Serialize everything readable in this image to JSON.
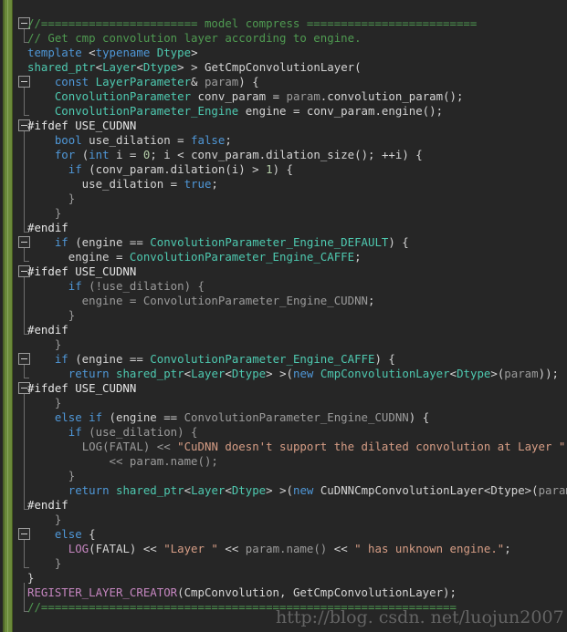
{
  "editor": {
    "background_color": "#262626",
    "change_bar_color": "#6b8a3a",
    "font_size_px": 12.4,
    "line_height_px": 16,
    "language": "C++",
    "colors": {
      "plain": "#d4d4d4",
      "comment": "#4f9a51",
      "keyword": "#4f97d7",
      "type": "#4ec9b0",
      "preprocessor": "#e6e6e6",
      "string": "#d69d85",
      "macro": "#c586c0",
      "variable": "#9b9b9b",
      "number": "#b5cea8"
    }
  },
  "watermark": {
    "text": "http://blog. csdn. net/luojun2007"
  },
  "fold_markers": [
    {
      "name": "fold-marker-model-compress-comment",
      "line": 1,
      "state": "expanded"
    },
    {
      "name": "fold-marker-function-body",
      "line": 5,
      "state": "expanded"
    },
    {
      "name": "fold-marker-ifdef-use-cudnn-1",
      "line": 8,
      "state": "expanded"
    },
    {
      "name": "fold-marker-if-engine-default",
      "line": 16,
      "state": "expanded"
    },
    {
      "name": "fold-marker-ifdef-use-cudnn-2",
      "line": 18,
      "state": "expanded"
    },
    {
      "name": "fold-marker-if-engine-caffe",
      "line": 24,
      "state": "expanded"
    },
    {
      "name": "fold-marker-ifdef-use-cudnn-3",
      "line": 26,
      "state": "expanded"
    },
    {
      "name": "fold-marker-else-block",
      "line": 36,
      "state": "expanded"
    }
  ],
  "code_lines": [
    {
      "n": 1,
      "text": "//======================= model compress ========================="
    },
    {
      "n": 2,
      "text": "// Get cmp convolution layer according to engine."
    },
    {
      "n": 3,
      "text": "template <typename Dtype>"
    },
    {
      "n": 4,
      "text": "shared_ptr<Layer<Dtype> > GetCmpConvolutionLayer("
    },
    {
      "n": 5,
      "text": "    const LayerParameter& param) {"
    },
    {
      "n": 6,
      "text": "    ConvolutionParameter conv_param = param.convolution_param();"
    },
    {
      "n": 7,
      "text": "    ConvolutionParameter_Engine engine = conv_param.engine();"
    },
    {
      "n": 8,
      "text": "#ifdef USE_CUDNN"
    },
    {
      "n": 9,
      "text": "    bool use_dilation = false;"
    },
    {
      "n": 10,
      "text": "    for (int i = 0; i < conv_param.dilation_size(); ++i) {"
    },
    {
      "n": 11,
      "text": "      if (conv_param.dilation(i) > 1) {"
    },
    {
      "n": 12,
      "text": "        use_dilation = true;"
    },
    {
      "n": 13,
      "text": "      }"
    },
    {
      "n": 14,
      "text": "    }"
    },
    {
      "n": 15,
      "text": "#endif"
    },
    {
      "n": 16,
      "text": "    if (engine == ConvolutionParameter_Engine_DEFAULT) {"
    },
    {
      "n": 17,
      "text": "      engine = ConvolutionParameter_Engine_CAFFE;"
    },
    {
      "n": 18,
      "text": "#ifdef USE_CUDNN"
    },
    {
      "n": 19,
      "text": "      if (!use_dilation) {"
    },
    {
      "n": 20,
      "text": "        engine = ConvolutionParameter_Engine_CUDNN;"
    },
    {
      "n": 21,
      "text": "      }"
    },
    {
      "n": 22,
      "text": "#endif"
    },
    {
      "n": 23,
      "text": "    }"
    },
    {
      "n": 24,
      "text": "    if (engine == ConvolutionParameter_Engine_CAFFE) {"
    },
    {
      "n": 25,
      "text": "      return shared_ptr<Layer<Dtype> >(new CmpConvolutionLayer<Dtype>(param));"
    },
    {
      "n": 26,
      "text": "#ifdef USE_CUDNN"
    },
    {
      "n": 27,
      "text": "    }"
    },
    {
      "n": 28,
      "text": "    else if (engine == ConvolutionParameter_Engine_CUDNN) {"
    },
    {
      "n": 29,
      "text": "      if (use_dilation) {"
    },
    {
      "n": 30,
      "text": "        LOG(FATAL) << \"CuDNN doesn't support the dilated convolution at Layer \""
    },
    {
      "n": 31,
      "text": "            << param.name();"
    },
    {
      "n": 32,
      "text": "      }"
    },
    {
      "n": 33,
      "text": "      return shared_ptr<Layer<Dtype> >(new CuDNNCmpConvolutionLayer<Dtype>(param));"
    },
    {
      "n": 34,
      "text": "#endif"
    },
    {
      "n": 35,
      "text": "    }"
    },
    {
      "n": 36,
      "text": "    else {"
    },
    {
      "n": 37,
      "text": "      LOG(FATAL) << \"Layer \" << param.name() << \" has unknown engine.\";"
    },
    {
      "n": 38,
      "text": "    }"
    },
    {
      "n": 39,
      "text": "}"
    },
    {
      "n": 40,
      "text": "REGISTER_LAYER_CREATOR(CmpConvolution, GetCmpConvolutionLayer);"
    },
    {
      "n": 41,
      "text": "//============================================================="
    }
  ],
  "code_tokens": [
    [
      {
        "t": "//======================= model compress =========================",
        "c": "comment"
      }
    ],
    [
      {
        "t": "// Get cmp convolution layer according to engine.",
        "c": "comment"
      }
    ],
    [
      {
        "t": "template ",
        "c": "kw"
      },
      {
        "t": "<",
        "c": "punc"
      },
      {
        "t": "typename ",
        "c": "kw"
      },
      {
        "t": "Dtype",
        "c": "type"
      },
      {
        "t": ">",
        "c": "punc"
      }
    ],
    [
      {
        "t": "shared_ptr",
        "c": "type"
      },
      {
        "t": "<",
        "c": "punc"
      },
      {
        "t": "Layer",
        "c": "type"
      },
      {
        "t": "<",
        "c": "punc"
      },
      {
        "t": "Dtype",
        "c": "type"
      },
      {
        "t": "> > ",
        "c": "punc"
      },
      {
        "t": "GetCmpConvolutionLayer(",
        "c": "plain"
      }
    ],
    [
      {
        "t": "    ",
        "c": "plain"
      },
      {
        "t": "const ",
        "c": "kw"
      },
      {
        "t": "LayerParameter",
        "c": "type"
      },
      {
        "t": "& ",
        "c": "punc"
      },
      {
        "t": "param",
        "c": "var"
      },
      {
        "t": ") {",
        "c": "punc"
      }
    ],
    [
      {
        "t": "    ",
        "c": "plain"
      },
      {
        "t": "ConvolutionParameter",
        "c": "type"
      },
      {
        "t": " conv_param = ",
        "c": "plain"
      },
      {
        "t": "param",
        "c": "var"
      },
      {
        "t": ".convolution_param();",
        "c": "plain"
      }
    ],
    [
      {
        "t": "    ",
        "c": "plain"
      },
      {
        "t": "ConvolutionParameter_Engine",
        "c": "type"
      },
      {
        "t": " engine = conv_param.engine();",
        "c": "plain"
      }
    ],
    [
      {
        "t": "#ifdef USE_CUDNN",
        "c": "pp"
      }
    ],
    [
      {
        "t": "    ",
        "c": "plain"
      },
      {
        "t": "bool",
        "c": "kw"
      },
      {
        "t": " use_dilation = ",
        "c": "plain"
      },
      {
        "t": "false",
        "c": "kw"
      },
      {
        "t": ";",
        "c": "punc"
      }
    ],
    [
      {
        "t": "    ",
        "c": "plain"
      },
      {
        "t": "for",
        "c": "kw"
      },
      {
        "t": " (",
        "c": "punc"
      },
      {
        "t": "int",
        "c": "kw"
      },
      {
        "t": " i = ",
        "c": "plain"
      },
      {
        "t": "0",
        "c": "num"
      },
      {
        "t": "; i < conv_param.dilation_size(); ++i) {",
        "c": "plain"
      }
    ],
    [
      {
        "t": "      ",
        "c": "plain"
      },
      {
        "t": "if",
        "c": "kw"
      },
      {
        "t": " (conv_param.dilation(i) > ",
        "c": "plain"
      },
      {
        "t": "1",
        "c": "num"
      },
      {
        "t": ") {",
        "c": "plain"
      }
    ],
    [
      {
        "t": "        use_dilation = ",
        "c": "plain"
      },
      {
        "t": "true",
        "c": "kw"
      },
      {
        "t": ";",
        "c": "punc"
      }
    ],
    [
      {
        "t": "      }",
        "c": "var"
      }
    ],
    [
      {
        "t": "    }",
        "c": "var"
      }
    ],
    [
      {
        "t": "#endif",
        "c": "pp"
      }
    ],
    [
      {
        "t": "    ",
        "c": "plain"
      },
      {
        "t": "if",
        "c": "kw"
      },
      {
        "t": " (engine == ",
        "c": "plain"
      },
      {
        "t": "ConvolutionParameter_Engine_DEFAULT",
        "c": "type"
      },
      {
        "t": ") {",
        "c": "plain"
      }
    ],
    [
      {
        "t": "      engine = ",
        "c": "plain"
      },
      {
        "t": "ConvolutionParameter_Engine_CAFFE",
        "c": "type"
      },
      {
        "t": ";",
        "c": "punc"
      }
    ],
    [
      {
        "t": "#ifdef USE_CUDNN",
        "c": "pp"
      }
    ],
    [
      {
        "t": "      ",
        "c": "plain"
      },
      {
        "t": "if",
        "c": "kw"
      },
      {
        "t": " (!use_dilation) {",
        "c": "var"
      }
    ],
    [
      {
        "t": "        engine = ",
        "c": "var"
      },
      {
        "t": "ConvolutionParameter_Engine_CUDNN",
        "c": "var"
      },
      {
        "t": ";",
        "c": "punc"
      }
    ],
    [
      {
        "t": "      }",
        "c": "var"
      }
    ],
    [
      {
        "t": "#endif",
        "c": "pp"
      }
    ],
    [
      {
        "t": "    }",
        "c": "var"
      }
    ],
    [
      {
        "t": "    ",
        "c": "plain"
      },
      {
        "t": "if",
        "c": "kw"
      },
      {
        "t": " (engine == ",
        "c": "plain"
      },
      {
        "t": "ConvolutionParameter_Engine_CAFFE",
        "c": "type"
      },
      {
        "t": ") {",
        "c": "plain"
      }
    ],
    [
      {
        "t": "      ",
        "c": "plain"
      },
      {
        "t": "return ",
        "c": "kw"
      },
      {
        "t": "shared_ptr",
        "c": "type"
      },
      {
        "t": "<",
        "c": "punc"
      },
      {
        "t": "Layer",
        "c": "type"
      },
      {
        "t": "<",
        "c": "punc"
      },
      {
        "t": "Dtype",
        "c": "type"
      },
      {
        "t": "> >(",
        "c": "punc"
      },
      {
        "t": "new ",
        "c": "kw"
      },
      {
        "t": "CmpConvolutionLayer",
        "c": "type"
      },
      {
        "t": "<",
        "c": "punc"
      },
      {
        "t": "Dtype",
        "c": "type"
      },
      {
        "t": ">(",
        "c": "punc"
      },
      {
        "t": "param",
        "c": "var"
      },
      {
        "t": "));",
        "c": "punc"
      }
    ],
    [
      {
        "t": "#ifdef USE_CUDNN",
        "c": "pp"
      }
    ],
    [
      {
        "t": "    }",
        "c": "var"
      }
    ],
    [
      {
        "t": "    ",
        "c": "plain"
      },
      {
        "t": "else if",
        "c": "kw"
      },
      {
        "t": " (engine == ",
        "c": "plain"
      },
      {
        "t": "ConvolutionParameter_Engine_CUDNN",
        "c": "var"
      },
      {
        "t": ") {",
        "c": "plain"
      }
    ],
    [
      {
        "t": "      ",
        "c": "plain"
      },
      {
        "t": "if",
        "c": "kw"
      },
      {
        "t": " (use_dilation) {",
        "c": "var"
      }
    ],
    [
      {
        "t": "        ",
        "c": "plain"
      },
      {
        "t": "LOG",
        "c": "var"
      },
      {
        "t": "(FATAL) << ",
        "c": "var"
      },
      {
        "t": "\"CuDNN doesn't support the dilated convolution at Layer \"",
        "c": "str"
      }
    ],
    [
      {
        "t": "            << param.name();",
        "c": "var"
      }
    ],
    [
      {
        "t": "      }",
        "c": "var"
      }
    ],
    [
      {
        "t": "      ",
        "c": "plain"
      },
      {
        "t": "return ",
        "c": "kw"
      },
      {
        "t": "shared_ptr",
        "c": "type"
      },
      {
        "t": "<",
        "c": "punc"
      },
      {
        "t": "Layer",
        "c": "type"
      },
      {
        "t": "<",
        "c": "punc"
      },
      {
        "t": "Dtype",
        "c": "type"
      },
      {
        "t": "> >(",
        "c": "punc"
      },
      {
        "t": "new ",
        "c": "kw"
      },
      {
        "t": "CuDNNCmpConvolutionLayer",
        "c": "plain"
      },
      {
        "t": "<",
        "c": "punc"
      },
      {
        "t": "Dtype",
        "c": "plain"
      },
      {
        "t": ">(",
        "c": "punc"
      },
      {
        "t": "param",
        "c": "var"
      },
      {
        "t": "));",
        "c": "punc"
      }
    ],
    [
      {
        "t": "#endif",
        "c": "pp"
      }
    ],
    [
      {
        "t": "    }",
        "c": "var"
      }
    ],
    [
      {
        "t": "    ",
        "c": "plain"
      },
      {
        "t": "else",
        "c": "kw"
      },
      {
        "t": " {",
        "c": "plain"
      }
    ],
    [
      {
        "t": "      ",
        "c": "plain"
      },
      {
        "t": "LOG",
        "c": "macro"
      },
      {
        "t": "(FATAL)",
        "c": "plain"
      },
      {
        "t": " << ",
        "c": "plain"
      },
      {
        "t": "\"Layer \"",
        "c": "str"
      },
      {
        "t": " << ",
        "c": "plain"
      },
      {
        "t": "param.name()",
        "c": "var"
      },
      {
        "t": " << ",
        "c": "plain"
      },
      {
        "t": "\" has unknown engine.\"",
        "c": "str"
      },
      {
        "t": ";",
        "c": "punc"
      }
    ],
    [
      {
        "t": "    }",
        "c": "var"
      }
    ],
    [
      {
        "t": "}",
        "c": "plain"
      }
    ],
    [
      {
        "t": "REGISTER_LAYER_CREATOR",
        "c": "macro"
      },
      {
        "t": "(CmpConvolution, GetCmpConvolutionLayer);",
        "c": "plain"
      }
    ],
    [
      {
        "t": "//=============================================================",
        "c": "comment"
      }
    ]
  ]
}
